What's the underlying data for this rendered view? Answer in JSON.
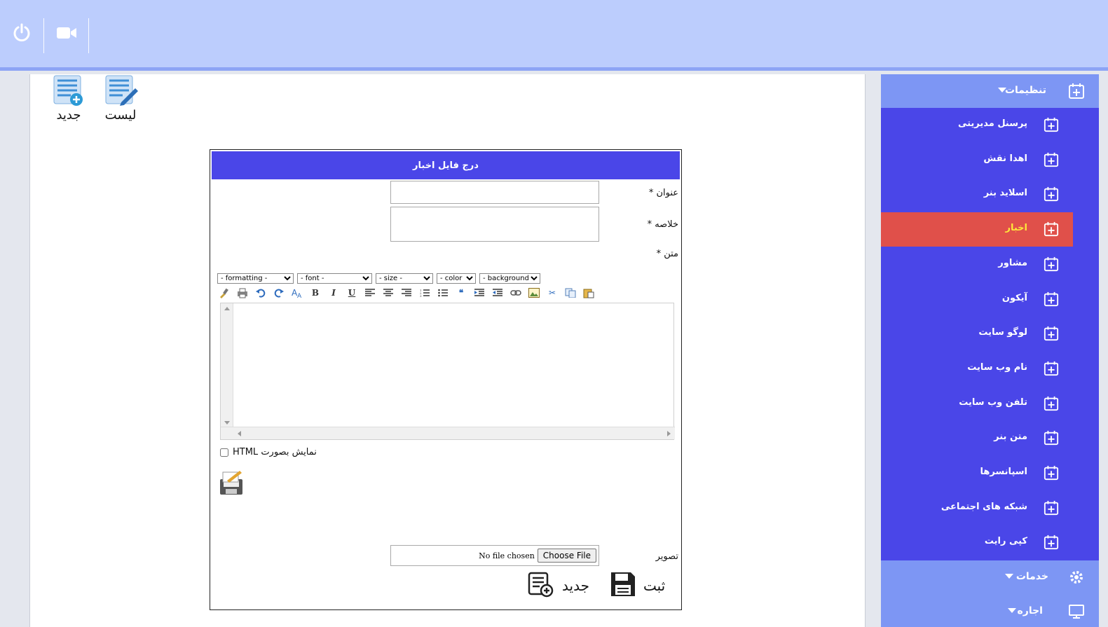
{
  "form": {
    "title": "درج فایل اخبار",
    "title_label": "عنوان *",
    "summary_label": "خلاصه *",
    "body_label": "متن *",
    "image_label": "تصویر",
    "file_button": "Choose File",
    "file_status": "No file chosen",
    "html_checkbox_label": "نمایش بصورت HTML",
    "submit_label": "ثبت",
    "new_label": "جدید"
  },
  "top_actions": {
    "list_label": "لیست",
    "new_label": "جدید"
  },
  "editor": {
    "selects": [
      "- formatting -",
      "- font -",
      "- size -",
      "- color -",
      "- background -"
    ],
    "tools": [
      "clean-icon",
      "print-icon",
      "undo-icon",
      "redo-icon",
      "spellcheck-icon",
      "bold-icon",
      "italic-icon",
      "underline-icon",
      "align-left-icon",
      "align-center-icon",
      "align-right-icon",
      "ordered-list-icon",
      "unordered-list-icon",
      "quote-icon",
      "indent-icon",
      "outdent-icon",
      "link-icon",
      "image-icon",
      "cut-icon",
      "copy-icon",
      "paste-icon"
    ]
  },
  "sidebar": {
    "settings_label": "تنظیمات",
    "items": [
      {
        "label": "پرسنل مدیریتی"
      },
      {
        "label": "اهدا نقش"
      },
      {
        "label": "اسلاید بنر"
      },
      {
        "label": "اخبار",
        "active": true
      },
      {
        "label": "مشاور"
      },
      {
        "label": "آیکون"
      },
      {
        "label": "لوگو سایت"
      },
      {
        "label": "نام وب سایت"
      },
      {
        "label": "تلفن وب سایت"
      },
      {
        "label": "متن بنر"
      },
      {
        "label": "اسپانسرها"
      },
      {
        "label": "شبکه های اجتماعی"
      },
      {
        "label": "کپی رایت"
      }
    ],
    "services_label": "خدمات",
    "rent_label": "اجاره"
  },
  "colors": {
    "topbar": "#bccdfd",
    "sidebar": "#4a46e8",
    "sidebar_head": "#7d96f4",
    "active_item": "#e0504a",
    "active_text": "#ffe83a",
    "form_header": "#4a46e8"
  }
}
